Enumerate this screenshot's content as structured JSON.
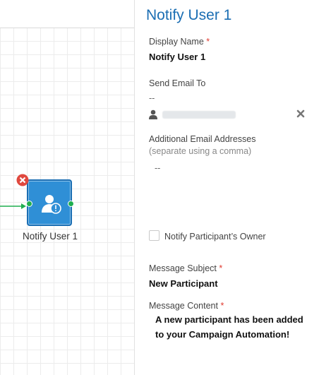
{
  "canvas": {
    "node": {
      "label": "Notify User 1",
      "icon": "user-alert-icon",
      "color": "#2f8fd6"
    },
    "connector_color": "#1fae4f",
    "delete_icon": "close-circle-icon"
  },
  "panel": {
    "title": "Notify User 1",
    "display_name": {
      "label": "Display Name",
      "required": "*",
      "value": "Notify User 1"
    },
    "send_email_to": {
      "label": "Send Email To",
      "value": "--",
      "user_icon": "user-icon",
      "remove_icon": "close-icon"
    },
    "additional_emails": {
      "label": "Additional Email Addresses",
      "hint": "(separate using a comma)",
      "value": "--"
    },
    "notify_owner": {
      "label": "Notify Participant’s Owner",
      "checked": false
    },
    "message_subject": {
      "label": "Message Subject",
      "required": "*",
      "value": "New Participant"
    },
    "message_content": {
      "label": "Message Content",
      "required": "*",
      "value": "A new participant has been added to your Campaign Automation!"
    },
    "accent_color": "#1b6eb3",
    "required_color": "#e03a2f"
  }
}
